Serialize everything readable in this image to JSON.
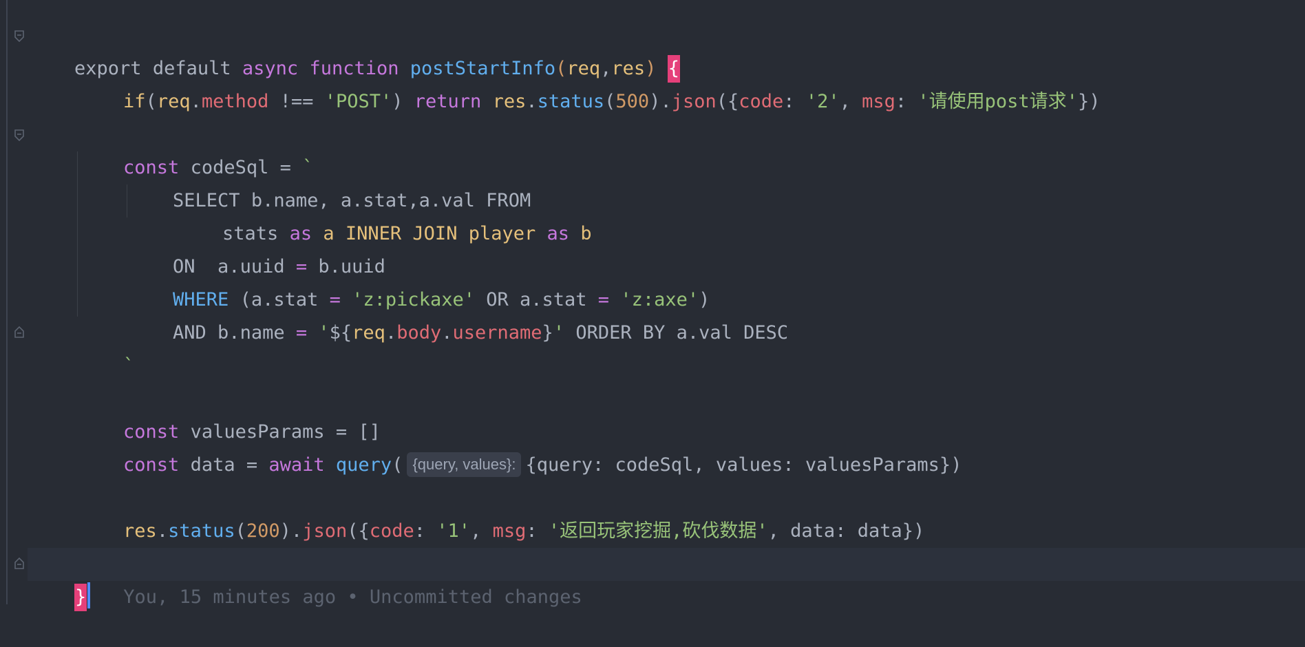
{
  "editor": {
    "line1": {
      "kw_export": "export",
      "kw_default": "default",
      "kw_async": "async",
      "kw_function": "function",
      "fn_name": "postStartInfo",
      "open_paren": "(",
      "param_req": "req",
      "comma": ",",
      "param_res": "res",
      "close_paren": ")",
      "open_brace": "{"
    },
    "line2": {
      "kw_if": "if",
      "p1": "(",
      "req": "req",
      "dot1": ".",
      "method": "method",
      "neq": " !== ",
      "post_str": "'POST'",
      "p2": ") ",
      "kw_return": "return",
      "res": "res",
      "dot2": ".",
      "status": "status",
      "p3": "(",
      "num500": "500",
      "p4": ").",
      "json": "json",
      "p5": "({",
      "code_key": "code",
      "colon1": ": ",
      "code_val": "'2'",
      "comma1": ", ",
      "msg_key": "msg",
      "colon2": ": ",
      "msg_val": "'请使用post请求'",
      "p6": "})"
    },
    "line4": {
      "kw_const": "const",
      "name": "codeSql",
      "eq": " = ",
      "tick": "`"
    },
    "line5": "SELECT b.name, a.stat,a.val FROM",
    "line6": {
      "stats": "stats ",
      "as1": "as",
      "a": "a",
      "join": "INNER JOIN",
      "player": "player",
      "as2": "as",
      "b": "b"
    },
    "line7": {
      "on": "ON  a.uuid ",
      "eq": "=",
      "rest": " b.uuid"
    },
    "line8": {
      "where": "WHERE",
      "p1": " (a.stat ",
      "eq1": "=",
      "str1": "'z:pickaxe'",
      "or": " OR a.stat ",
      "eq2": "=",
      "str2": "'z:axe'",
      "p2": ")"
    },
    "line9": {
      "and": "AND b.name ",
      "eq": "=",
      "q1": "'",
      "interp_open": "${",
      "req": "req",
      "dot1": ".",
      "body": "body",
      "dot2": ".",
      "username": "username",
      "interp_close": "}",
      "q2": "'",
      "order": " ORDER BY a.val DESC"
    },
    "line10": "`",
    "line12": {
      "kw_const": "const",
      "rest": " valuesParams = []"
    },
    "line13": {
      "kw_const": "const",
      "name": " data = ",
      "kw_await": "await",
      "fn_query": "query",
      "p1": "(",
      "hint": "{query, values}:",
      "args": "{query: codeSql, values: valuesParams})"
    },
    "line15": {
      "res": "res",
      "dot1": ".",
      "status": "status",
      "p1": "(",
      "num200": "200",
      "p2": ").",
      "json": "json",
      "p3": "({",
      "code_key": "code",
      "colon1": ": ",
      "code_val": "'1'",
      "comma1": ", ",
      "msg_key": "msg",
      "colon2": ": ",
      "msg_val": "'返回玩家挖掘,砍伐数据'",
      "rest": ", data: data})"
    },
    "line17": {
      "close_brace": "}",
      "blame": "You, 15 minutes ago • Uncommitted changes"
    }
  },
  "colors": {
    "background": "#282c34",
    "keyword": "#c678dd",
    "function": "#61afef",
    "parameter": "#e5c07b",
    "property": "#e06c75",
    "string": "#98c379",
    "number": "#d19a66",
    "bracket_highlight": "#e5407a",
    "blame_text": "#5c6370"
  }
}
